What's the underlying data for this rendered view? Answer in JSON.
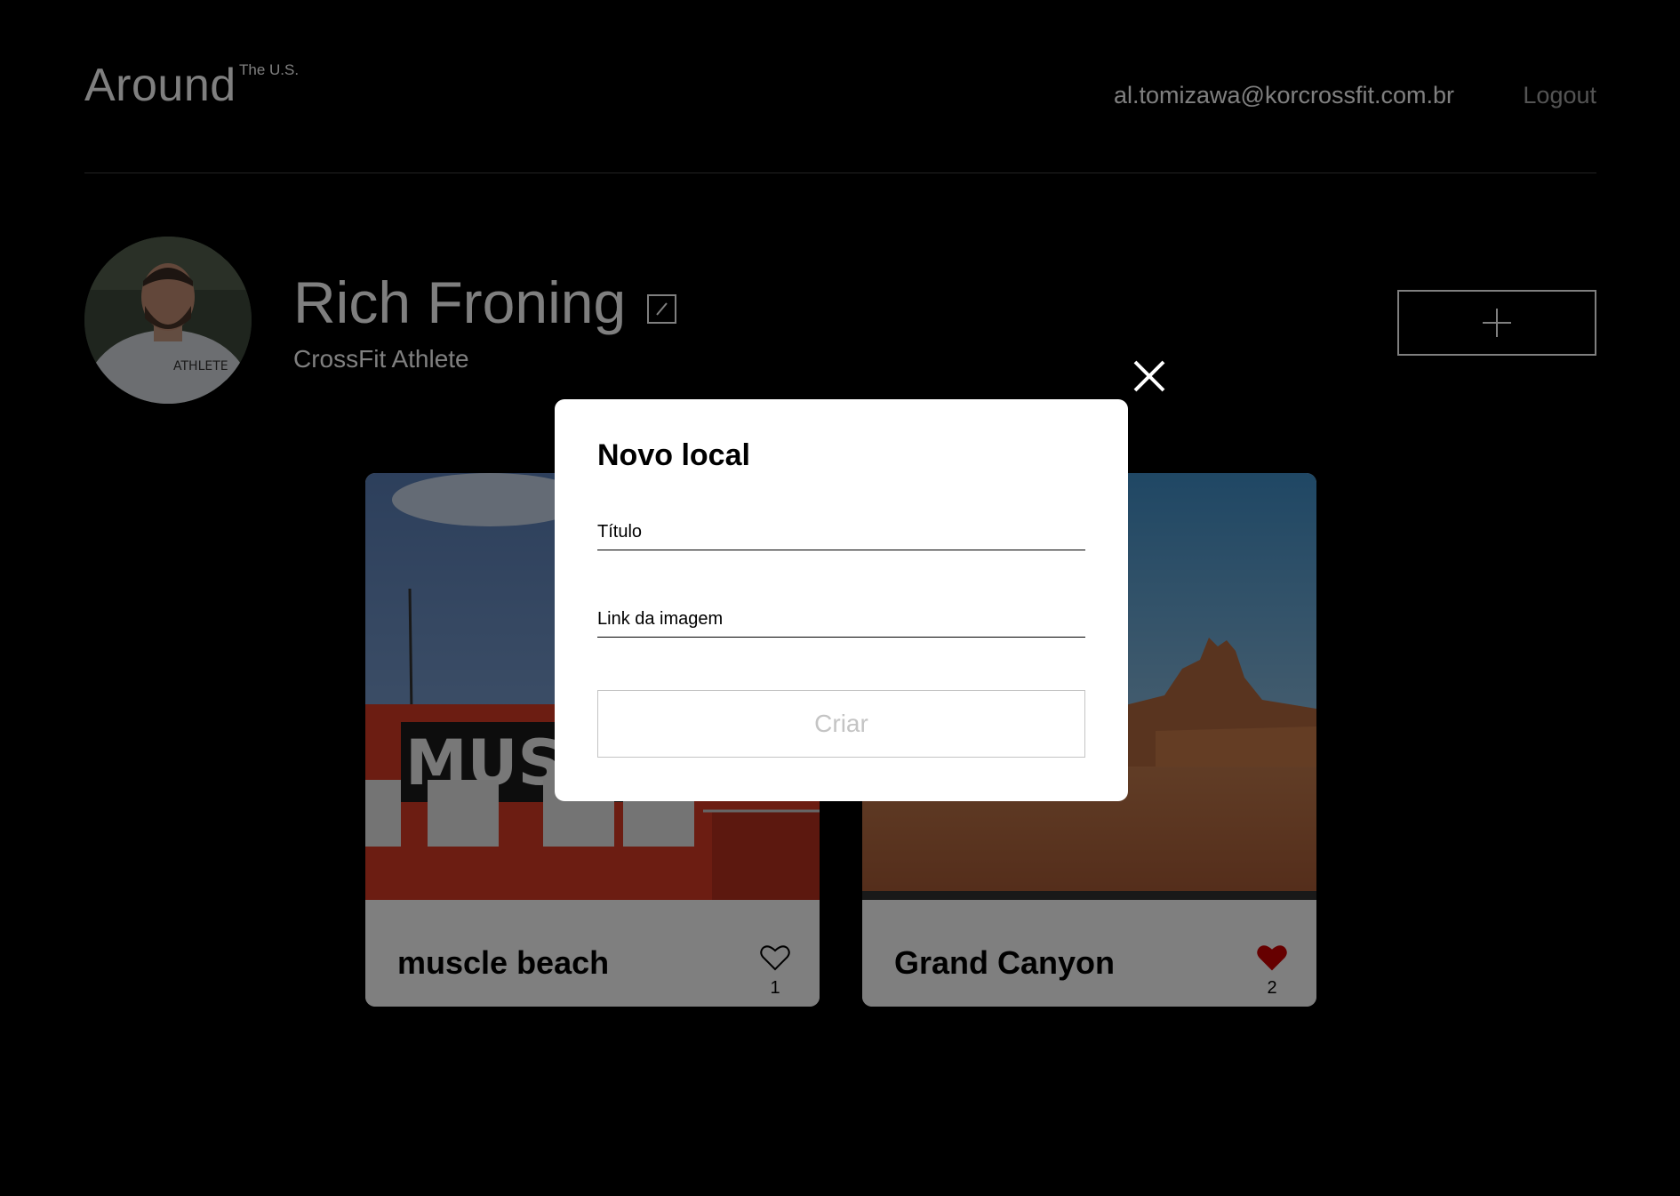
{
  "header": {
    "logo": "Around",
    "logo_sup": "The U.S.",
    "user_email": "al.tomizawa@korcrossfit.com.br",
    "logout_label": "Logout"
  },
  "profile": {
    "name": "Rich Froning",
    "about": "CrossFit Athlete",
    "avatar_icon": "avatar-photo",
    "edit_icon": "pencil-icon",
    "add_icon": "plus-icon"
  },
  "cards": [
    {
      "title": "muscle beach",
      "likes": "1",
      "liked": false,
      "image_icon": "muscle-beach-photo"
    },
    {
      "title": "Grand Canyon",
      "likes": "2",
      "liked": true,
      "image_icon": "grand-canyon-photo"
    }
  ],
  "modal": {
    "title": "Novo local",
    "title_placeholder": "Título",
    "link_placeholder": "Link da imagem",
    "submit_label": "Criar",
    "close_icon": "close-icon"
  },
  "colors": {
    "background": "#000000",
    "text": "#ffffff",
    "like_active": "#cc0000",
    "overlay": "rgba(0,0,0,0.5)",
    "button_disabled": "#c4c4c4"
  }
}
